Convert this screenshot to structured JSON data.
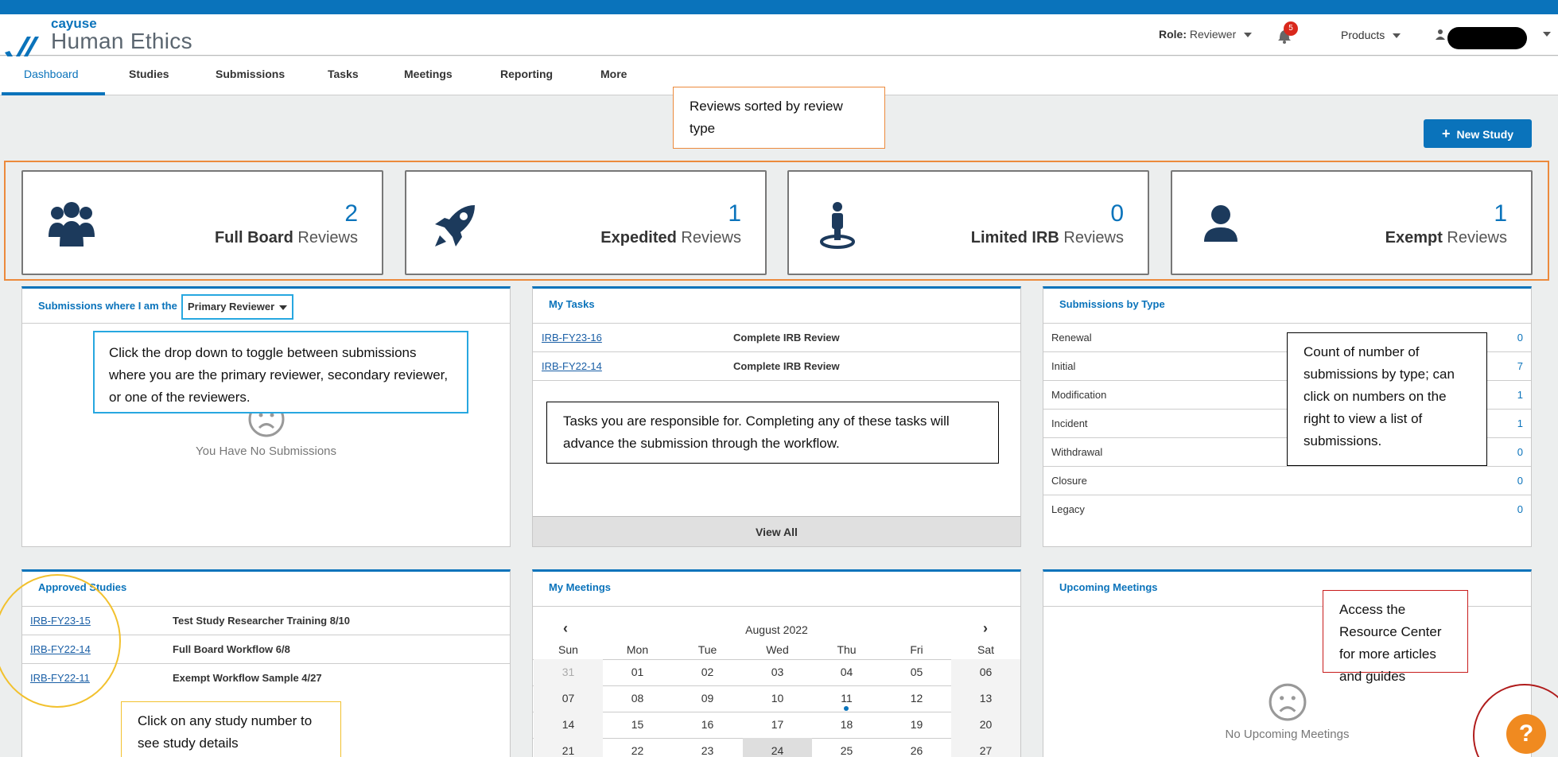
{
  "brand": {
    "top": "cayuse",
    "main": "Human Ethics"
  },
  "header": {
    "role_label": "Role:",
    "role_value": "Reviewer",
    "notification_count": "5",
    "products": "Products"
  },
  "nav": [
    "Dashboard",
    "Studies",
    "Submissions",
    "Tasks",
    "Meetings",
    "Reporting",
    "More"
  ],
  "new_study": "New Study",
  "annotations": {
    "sorted": "Reviews sorted by review type",
    "dropdown": "Click the drop down to toggle between submissions where you are the primary reviewer, secondary reviewer, or one of the reviewers.",
    "tasks": "Tasks you are responsible for. Completing any of these tasks will advance the submission through the workflow.",
    "count": "Count of number of submissions by type; can click on numbers on the right to view a list of submissions.",
    "study_number": "Click on any study number to see study details",
    "resource": "Access the Resource Center for more articles and guides"
  },
  "review_cards": [
    {
      "count": "2",
      "type": "Full Board",
      "suffix": "Reviews",
      "icon": "group-icon"
    },
    {
      "count": "1",
      "type": "Expedited",
      "suffix": "Reviews",
      "icon": "rocket-icon"
    },
    {
      "count": "0",
      "type": "Limited IRB",
      "suffix": "Reviews",
      "icon": "person-pin-icon"
    },
    {
      "count": "1",
      "type": "Exempt",
      "suffix": "Reviews",
      "icon": "user-icon"
    }
  ],
  "submissions_panel": {
    "title": "Submissions where I am the",
    "selector": "Primary Reviewer",
    "empty": "You Have No Submissions"
  },
  "tasks_panel": {
    "title": "My Tasks",
    "rows": [
      {
        "id": "IRB-FY23-16",
        "task": "Complete IRB Review"
      },
      {
        "id": "IRB-FY22-14",
        "task": "Complete IRB Review"
      }
    ],
    "view_all": "View All"
  },
  "by_type_panel": {
    "title": "Submissions by Type",
    "rows": [
      {
        "type": "Renewal",
        "count": "0"
      },
      {
        "type": "Initial",
        "count": "7"
      },
      {
        "type": "Modification",
        "count": "1"
      },
      {
        "type": "Incident",
        "count": "1"
      },
      {
        "type": "Withdrawal",
        "count": "0"
      },
      {
        "type": "Closure",
        "count": "0"
      },
      {
        "type": "Legacy",
        "count": "0"
      }
    ]
  },
  "approved_panel": {
    "title": "Approved Studies",
    "rows": [
      {
        "id": "IRB-FY23-15",
        "name": "Test Study Researcher Training 8/10"
      },
      {
        "id": "IRB-FY22-14",
        "name": "Full Board Workflow 6/8"
      },
      {
        "id": "IRB-FY22-11",
        "name": "Exempt Workflow Sample 4/27"
      }
    ]
  },
  "meetings_panel": {
    "title": "My Meetings",
    "month": "August",
    "year": "2022",
    "days": [
      "Sun",
      "Mon",
      "Tue",
      "Wed",
      "Thu",
      "Fri",
      "Sat"
    ],
    "weeks": [
      [
        "31",
        "01",
        "02",
        "03",
        "04",
        "05",
        "06"
      ],
      [
        "07",
        "08",
        "09",
        "10",
        "11",
        "12",
        "13"
      ],
      [
        "14",
        "15",
        "16",
        "17",
        "18",
        "19",
        "20"
      ],
      [
        "21",
        "22",
        "23",
        "24",
        "25",
        "26",
        "27"
      ]
    ]
  },
  "upcoming_panel": {
    "title": "Upcoming Meetings",
    "empty": "No Upcoming Meetings"
  },
  "help": "?"
}
